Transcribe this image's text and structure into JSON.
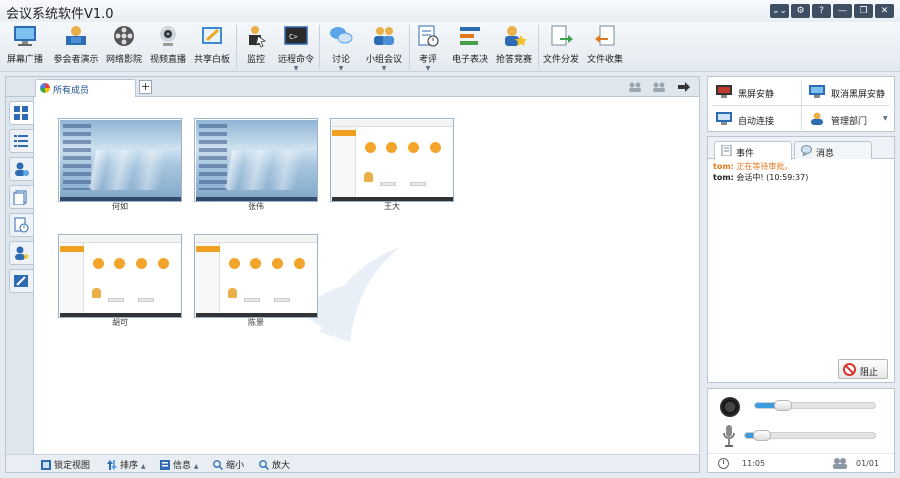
{
  "window": {
    "title": "会议系统软件V1.0",
    "controls": [
      "⌄⌄",
      "⚙",
      "?",
      "—",
      "❐",
      "✕"
    ]
  },
  "toolbar": {
    "items": [
      {
        "label": "屏幕广播",
        "icon": "monitor-broadcast-icon"
      },
      {
        "label": "参会者演示",
        "icon": "presenter-icon"
      },
      {
        "label": "网络影院",
        "icon": "film-reel-icon"
      },
      {
        "label": "视频直播",
        "icon": "webcam-icon"
      },
      {
        "label": "共享白板",
        "icon": "whiteboard-icon"
      },
      {
        "label": "监控",
        "icon": "monitor-user-icon"
      },
      {
        "label": "远程命令",
        "icon": "command-prompt-icon",
        "arrow": "▼"
      },
      {
        "label": "讨论",
        "icon": "chat-bubbles-icon",
        "arrow": "▼"
      },
      {
        "label": "小组会议",
        "icon": "group-meeting-icon",
        "arrow": "▼"
      },
      {
        "label": "考评",
        "icon": "evaluation-icon",
        "arrow": "▼"
      },
      {
        "label": "电子表决",
        "icon": "vote-icon"
      },
      {
        "label": "抢答竞赛",
        "icon": "contest-icon"
      },
      {
        "label": "文件分发",
        "icon": "file-send-icon"
      },
      {
        "label": "文件收集",
        "icon": "file-collect-icon"
      }
    ]
  },
  "members_tab": {
    "label": "所有成员",
    "add": "+"
  },
  "thumbnails": [
    {
      "name": "何如",
      "type": "desktop"
    },
    {
      "name": "张伟",
      "type": "desktop"
    },
    {
      "name": "王大",
      "type": "app"
    },
    {
      "name": "胡可",
      "type": "app"
    },
    {
      "name": "陈景",
      "type": "app"
    }
  ],
  "bottom_bar": {
    "lock_view": "锁定视图",
    "sort": "排序",
    "info": "信息",
    "zoom_out": "缩小",
    "zoom_in": "放大"
  },
  "right_actions": {
    "black_screen": "黑屏安静",
    "cancel_black_screen": "取消黑屏安静",
    "auto_connect": "自动连接",
    "manage_dept": "管理部门"
  },
  "event_tabs": {
    "events": "事件",
    "messages": "消息"
  },
  "events": [
    {
      "user": "tom:",
      "text": "正在等待审批。",
      "color": "#e07a1f"
    },
    {
      "user": "tom:",
      "text": "会话中! (10:59:37)",
      "color": "#222222"
    }
  ],
  "stop_button": "阻止",
  "audio": {
    "camera_level": 0.16,
    "mic_level": 0.06
  },
  "status": {
    "time": "11:05",
    "count": "01/01"
  },
  "colors": {
    "accent": "#3d9be0",
    "pending": "#e07a1f",
    "app_orange": "#f2a52a"
  }
}
